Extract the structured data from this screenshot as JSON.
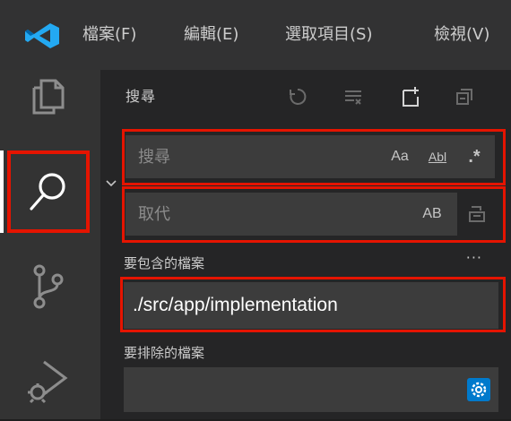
{
  "colors": {
    "menubar_bg": "#323233",
    "activitybar_bg": "#333333",
    "sidebar_bg": "#252526",
    "input_bg": "#3c3c3c",
    "highlight_red": "#e51400",
    "vscode_blue": "#23a9f2"
  },
  "menubar": {
    "items": [
      "檔案(F)",
      "編輯(E)",
      "選取項目(S)",
      "檢視(V)"
    ]
  },
  "activitybar": {
    "icons": [
      "files-icon",
      "search-icon",
      "source-control-icon",
      "run-debug-icon"
    ],
    "active": "search-icon"
  },
  "search_view": {
    "title": "搜尋",
    "actions": [
      "refresh-icon",
      "clear-results-icon",
      "new-search-editor-icon",
      "collapse-all-icon"
    ],
    "search_placeholder": "搜尋",
    "search_value": "",
    "match_case_label": "Aa",
    "whole_word_label": "Abl",
    "regex_label": ".*",
    "replace_placeholder": "取代",
    "replace_value": "",
    "preserve_case_label": "AB",
    "include_label": "要包含的檔案",
    "include_value": "./src/app/implementation",
    "more_label": "···",
    "exclude_label": "要排除的檔案",
    "exclude_value": ""
  }
}
